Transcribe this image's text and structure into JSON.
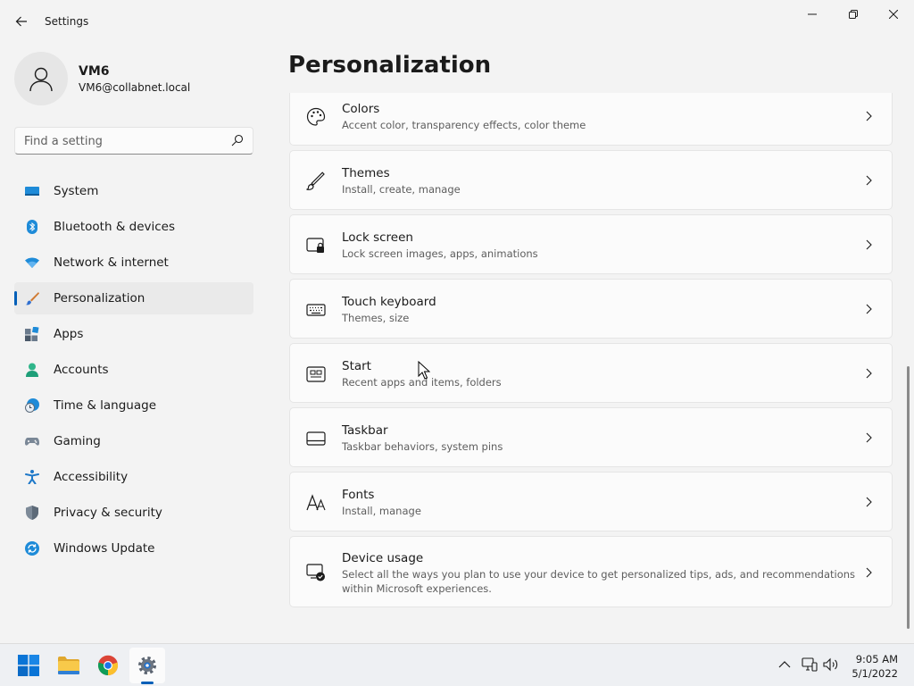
{
  "window": {
    "title": "Settings"
  },
  "account": {
    "name": "VM6",
    "email": "VM6@collabnet.local"
  },
  "search": {
    "placeholder": "Find a setting"
  },
  "nav": {
    "items": [
      {
        "label": "System",
        "icon": "system-icon"
      },
      {
        "label": "Bluetooth & devices",
        "icon": "bluetooth-icon"
      },
      {
        "label": "Network & internet",
        "icon": "wifi-icon"
      },
      {
        "label": "Personalization",
        "icon": "brush-icon",
        "active": true
      },
      {
        "label": "Apps",
        "icon": "apps-icon"
      },
      {
        "label": "Accounts",
        "icon": "accounts-icon"
      },
      {
        "label": "Time & language",
        "icon": "clock-globe-icon"
      },
      {
        "label": "Gaming",
        "icon": "gamepad-icon"
      },
      {
        "label": "Accessibility",
        "icon": "accessibility-icon"
      },
      {
        "label": "Privacy & security",
        "icon": "shield-icon"
      },
      {
        "label": "Windows Update",
        "icon": "update-icon"
      }
    ]
  },
  "main": {
    "title": "Personalization",
    "cards": [
      {
        "title": "Colors",
        "subtitle": "Accent color, transparency effects, color theme",
        "icon": "palette-icon"
      },
      {
        "title": "Themes",
        "subtitle": "Install, create, manage",
        "icon": "pen-brush-icon"
      },
      {
        "title": "Lock screen",
        "subtitle": "Lock screen images, apps, animations",
        "icon": "lock-screen-icon"
      },
      {
        "title": "Touch keyboard",
        "subtitle": "Themes, size",
        "icon": "keyboard-icon"
      },
      {
        "title": "Start",
        "subtitle": "Recent apps and items, folders",
        "icon": "start-icon"
      },
      {
        "title": "Taskbar",
        "subtitle": "Taskbar behaviors, system pins",
        "icon": "taskbar-icon"
      },
      {
        "title": "Fonts",
        "subtitle": "Install, manage",
        "icon": "fonts-icon"
      },
      {
        "title": "Device usage",
        "subtitle": "Select all the ways you plan to use your device to get personalized tips, ads, and recommendations within Microsoft experiences.",
        "icon": "device-usage-icon"
      }
    ]
  },
  "taskbar": {
    "time": "9:05 AM",
    "date": "5/1/2022"
  },
  "colors": {
    "accent": "#005fb8"
  }
}
